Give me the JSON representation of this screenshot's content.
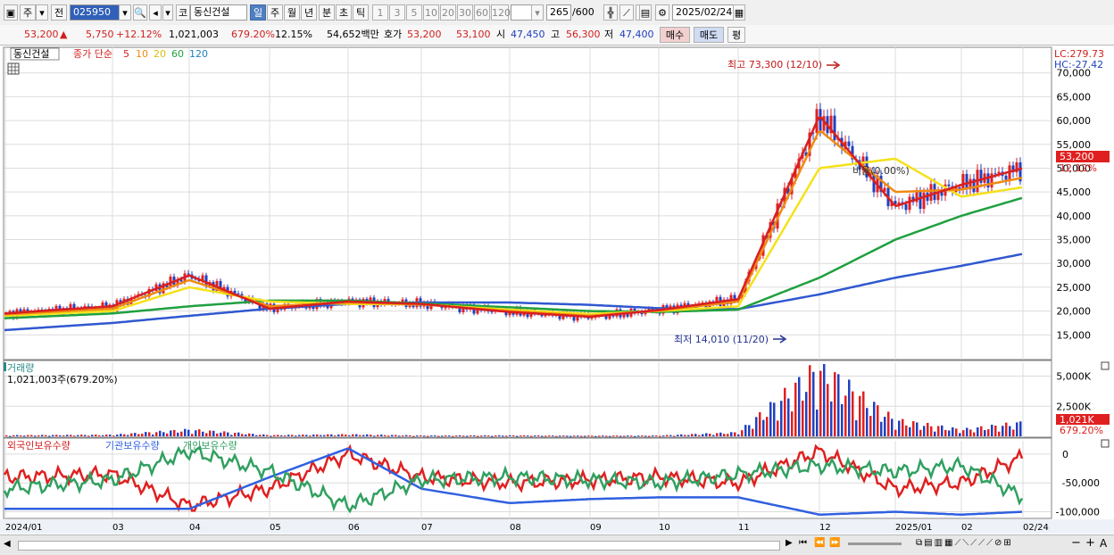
{
  "toolbar": {
    "market_label": "주",
    "prev_label": "전",
    "code": "025950",
    "market_type": "코",
    "stock_name": "동신건설",
    "periods": [
      "일",
      "주",
      "월",
      "년",
      "분",
      "초",
      "틱"
    ],
    "active_period": "일",
    "intervals": [
      "1",
      "3",
      "5",
      "10",
      "20",
      "30",
      "60",
      "120"
    ],
    "count": "265",
    "count_total": "/600",
    "date": "2025/02/24"
  },
  "quote": {
    "price": "53,200",
    "change": "5,750",
    "change_pct": "+12.12%",
    "volume": "1,021,003",
    "volume_ratio": "679.20%",
    "turnover": "12.15%",
    "amount": "54,652백만",
    "ask_label": "호가",
    "ask": "53,200",
    "bid": "53,100",
    "open_label": "시",
    "open": "47,450",
    "high_label": "고",
    "high": "56,300",
    "low_label": "저",
    "low": "47,400",
    "buy_label": "매수",
    "sell_label": "매도",
    "avg_label": "평"
  },
  "price_panel": {
    "name": "동신건설",
    "ma_label": "종가 단순",
    "ma_periods": [
      "5",
      "10",
      "20",
      "60",
      "120"
    ],
    "lc": "LC:279.73",
    "hc": "HC:-27.42",
    "high_annot": "최고 73,300 (12/10)",
    "low_annot": "최저 14,010 (11/20)",
    "overlay_text": "비율(0.00%)",
    "price_tag": "53,200",
    "pct_tag": "12.12%"
  },
  "volume_panel": {
    "title": "거래량",
    "value": "1,021,003주(679.20%)",
    "tag": "1,021K",
    "tag_pct": "679.20%"
  },
  "holding_panel": {
    "legend": [
      "외국인보유수량",
      "기관보유수량",
      "개인보유수량"
    ]
  },
  "x_axis": [
    "2024/01",
    "03",
    "04",
    "05",
    "06",
    "07",
    "08",
    "09",
    "10",
    "11",
    "12",
    "2025/01",
    "02",
    "02/24"
  ],
  "colors": {
    "ma5": "#d82020",
    "ma10": "#f08a10",
    "ma20": "#f5e11a",
    "ma60": "#20a040",
    "ma120": "#3058d0",
    "up": "#e02020",
    "down": "#2040c0",
    "foreign": "#e02020",
    "inst": "#3060e0",
    "retail": "#30a060"
  },
  "chart_data": [
    {
      "type": "line",
      "title": "동신건설",
      "ylabel": "",
      "y_ticks": [
        15000,
        20000,
        25000,
        30000,
        35000,
        40000,
        45000,
        50000,
        55000,
        60000,
        65000,
        70000
      ],
      "ylim": [
        10000,
        75000
      ],
      "x": [
        "2024/01",
        "03",
        "04",
        "05",
        "06",
        "07",
        "08",
        "09",
        "10",
        "11",
        "12",
        "2025/01",
        "02",
        "02/24"
      ],
      "series": [
        {
          "name": "5",
          "values": [
            19500,
            21000,
            27500,
            20500,
            22000,
            21500,
            19800,
            18800,
            20200,
            22500,
            61000,
            42000,
            46500,
            50000
          ]
        },
        {
          "name": "10",
          "values": [
            19300,
            20500,
            26500,
            21000,
            21800,
            21400,
            20000,
            19000,
            20100,
            22000,
            58000,
            45000,
            45500,
            48000
          ]
        },
        {
          "name": "20",
          "values": [
            19000,
            20000,
            25000,
            22000,
            21500,
            21400,
            20300,
            19400,
            20000,
            21000,
            50000,
            52000,
            44000,
            46000
          ]
        },
        {
          "name": "60",
          "values": [
            18500,
            19500,
            21000,
            22200,
            22200,
            21600,
            20800,
            20000,
            19800,
            20300,
            27000,
            35000,
            40000,
            43800
          ]
        },
        {
          "name": "120",
          "values": [
            16000,
            17500,
            19000,
            20500,
            21500,
            21800,
            21800,
            21300,
            20600,
            20400,
            23500,
            27000,
            29500,
            32000
          ]
        }
      ]
    },
    {
      "type": "bar",
      "title": "거래량",
      "y_ticks": [
        2500000,
        5000000
      ],
      "ylim": [
        0,
        6000000
      ],
      "categories": [
        "2024/01",
        "03",
        "04",
        "05",
        "06",
        "07",
        "08",
        "09",
        "10",
        "11",
        "12",
        "2025/01",
        "02",
        "02/24"
      ],
      "values": [
        80000,
        120000,
        500000,
        90000,
        150000,
        60000,
        70000,
        50000,
        60000,
        300000,
        5200000,
        1200000,
        500000,
        1021003
      ]
    },
    {
      "type": "line",
      "title": "외국인보유수량",
      "y_ticks": [
        0,
        -50000,
        -100000
      ],
      "ylim": [
        -110000,
        20000
      ],
      "x": [
        "2024/01",
        "03",
        "04",
        "05",
        "06",
        "07",
        "08",
        "09",
        "10",
        "11",
        "12",
        "2025/01",
        "02",
        "02/24"
      ],
      "series": [
        {
          "name": "외국인보유수량",
          "values": [
            -40000,
            -35000,
            -90000,
            -60000,
            0,
            -40000,
            -50000,
            -45000,
            -40000,
            -50000,
            5000,
            -60000,
            -50000,
            -5000
          ]
        },
        {
          "name": "기관보유수량",
          "values": [
            -95000,
            -95000,
            -95000,
            -40000,
            10000,
            -60000,
            -85000,
            -78000,
            -75000,
            -75000,
            -105000,
            -100000,
            -105000,
            -100000
          ]
        },
        {
          "name": "개인보유수량",
          "values": [
            -60000,
            -45000,
            5000,
            -30000,
            -90000,
            -45000,
            -40000,
            -45000,
            -50000,
            -35000,
            -20000,
            -30000,
            -20000,
            -75000
          ]
        }
      ]
    }
  ]
}
